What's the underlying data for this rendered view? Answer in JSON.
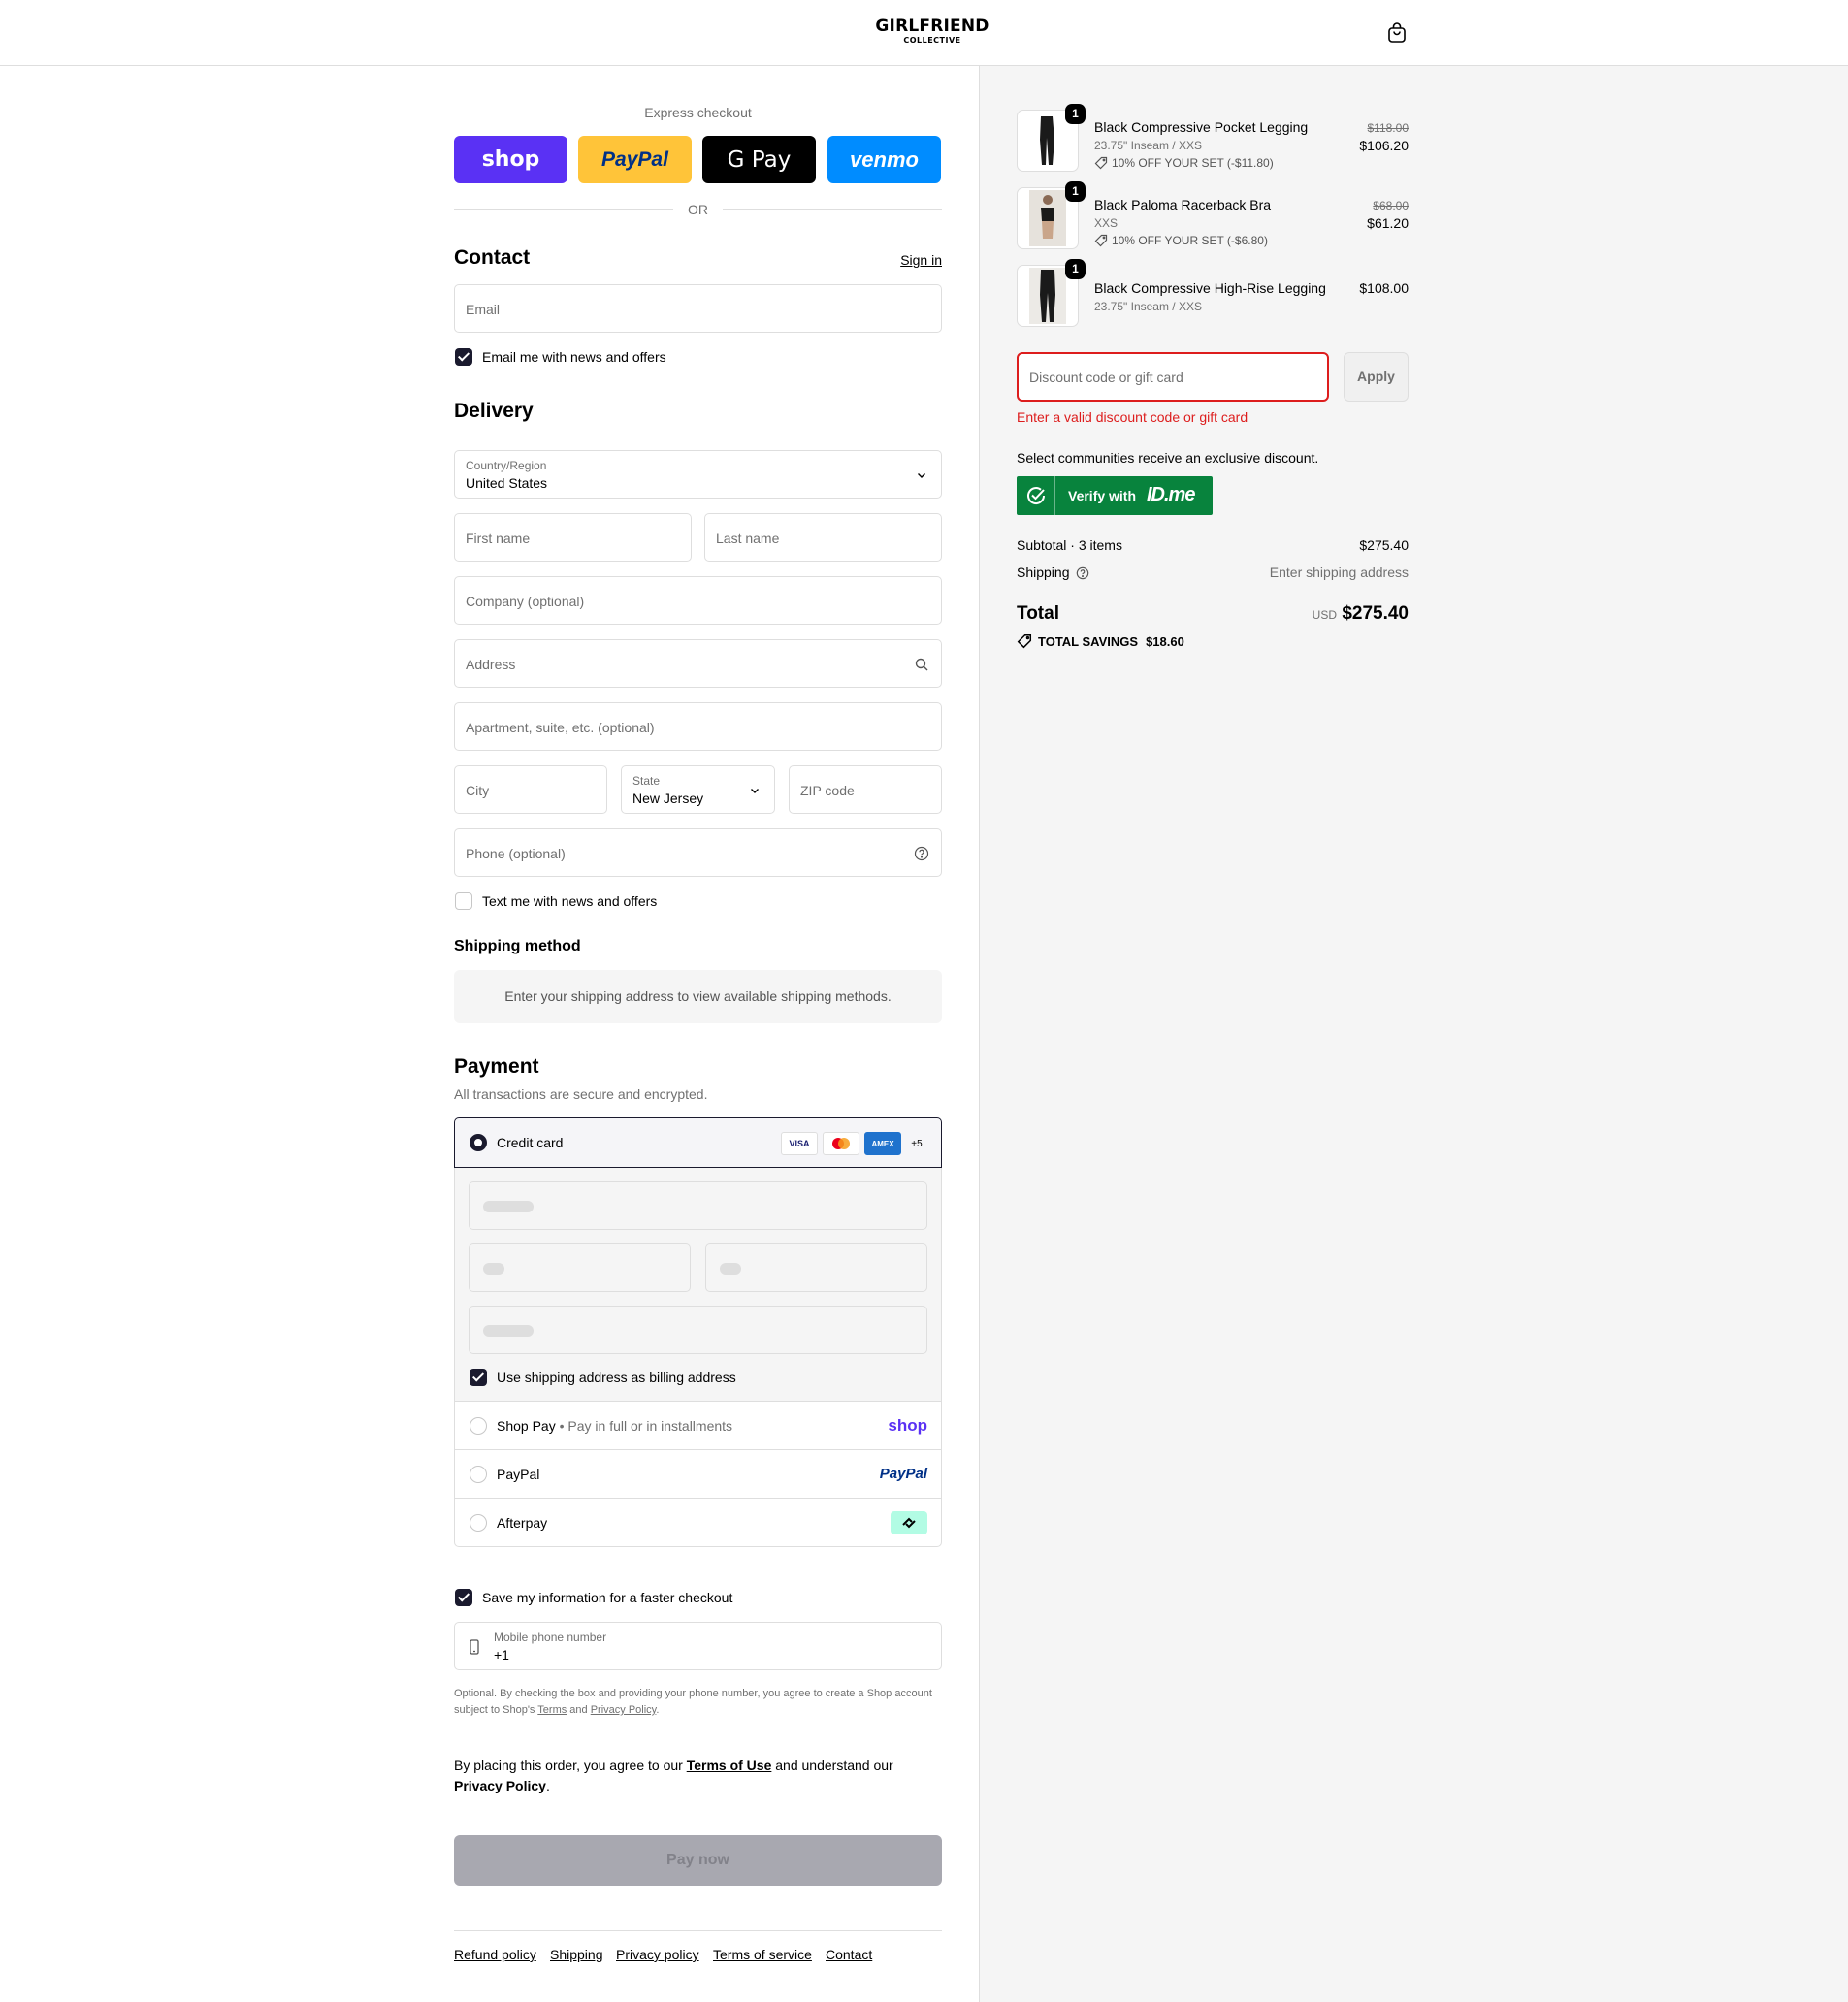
{
  "header": {
    "brand_line1": "GIRLFRIEND",
    "brand_line2": "COLLECTIVE"
  },
  "express": {
    "title": "Express checkout",
    "buttons": [
      {
        "label": "shop",
        "color": "#5a31f4"
      },
      {
        "label": "PayPal",
        "color": "#ffc439"
      },
      {
        "label": "G Pay",
        "color": "#000000"
      },
      {
        "label": "venmo",
        "color": "#008cff"
      }
    ],
    "or": "OR"
  },
  "contact": {
    "title": "Contact",
    "sign_in": "Sign in",
    "email_placeholder": "Email",
    "news_label": "Email me with news and offers",
    "news_checked": true
  },
  "delivery": {
    "title": "Delivery",
    "country_label": "Country/Region",
    "country_value": "United States",
    "first_name": "First name",
    "last_name": "Last name",
    "company": "Company (optional)",
    "address": "Address",
    "apartment": "Apartment, suite, etc. (optional)",
    "city": "City",
    "state_label": "State",
    "state_value": "New Jersey",
    "zip": "ZIP code",
    "phone": "Phone (optional)",
    "text_label": "Text me with news and offers",
    "text_checked": false
  },
  "shipping": {
    "title": "Shipping method",
    "message": "Enter your shipping address to view available shipping methods."
  },
  "payment": {
    "title": "Payment",
    "subtitle": "All transactions are secure and encrypted.",
    "credit_card": "Credit card",
    "card_logos": [
      "VISA",
      "MC",
      "AMEX",
      "+5"
    ],
    "billing_label": "Use shipping address as billing address",
    "shop_pay": "Shop Pay",
    "shop_pay_sep": "•",
    "shop_pay_note": "Pay in full or in installments",
    "shop_pay_logo": "shop",
    "paypal": "PayPal",
    "paypal_logo": "PayPal",
    "afterpay": "Afterpay"
  },
  "save": {
    "label": "Save my information for a faster checkout",
    "phone_label": "Mobile phone number",
    "phone_value": "+1",
    "note_pre": "Optional. By checking the box and providing your phone number, you agree to create a Shop account subject to Shop's ",
    "note_terms": "Terms",
    "note_and": " and ",
    "note_privacy": "Privacy Policy",
    "note_end": "."
  },
  "agreement": {
    "pre": "By placing this order, you agree to our ",
    "terms": "Terms of Use",
    "mid": " and understand our ",
    "privacy": "Privacy Policy",
    "end": "."
  },
  "pay_now": "Pay now",
  "footer": [
    "Refund policy",
    "Shipping",
    "Privacy policy",
    "Terms of service",
    "Contact"
  ],
  "cart": {
    "items": [
      {
        "qty": "1",
        "name": "Black Compressive Pocket Legging",
        "variant": "23.75\" Inseam / XXS",
        "discount": "10% OFF YOUR SET (-$11.80)",
        "old_price": "$118.00",
        "price": "$106.20"
      },
      {
        "qty": "1",
        "name": "Black Paloma Racerback Bra",
        "variant": "XXS",
        "discount": "10% OFF YOUR SET (-$6.80)",
        "old_price": "$68.00",
        "price": "$61.20"
      },
      {
        "qty": "1",
        "name": "Black Compressive High-Rise Legging",
        "variant": "23.75\" Inseam / XXS",
        "price": "$108.00"
      }
    ],
    "discount_placeholder": "Discount code or gift card",
    "apply": "Apply",
    "error": "Enter a valid discount code or gift card",
    "communities": "Select communities receive an exclusive discount.",
    "verify_label": "Verify with",
    "verify_brand": "ID.me",
    "subtotal_label": "Subtotal · 3 items",
    "subtotal_value": "$275.40",
    "shipping_label": "Shipping",
    "shipping_value": "Enter shipping address",
    "total_label": "Total",
    "currency": "USD",
    "total_value": "$275.40",
    "savings_label": "TOTAL SAVINGS",
    "savings_value": "$18.60"
  },
  "colors": {
    "error": "#dd1d1d",
    "idme_green": "#08833d",
    "dark": "#1a1a2e"
  }
}
